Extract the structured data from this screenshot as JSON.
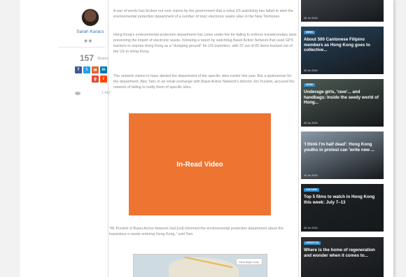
{
  "author": {
    "name": "Sarah Karacs",
    "social_icons": "◉◉",
    "share_count": "157",
    "share_word": "Shares",
    "views": "1,442"
  },
  "social": {
    "facebook_color": "#3b5998",
    "twitter_color": "#1da1f2",
    "email_color": "#e5622a",
    "linkedin_color": "#0077b5",
    "googleplus_color": "#dd4b39",
    "reddit_color": "#ff4500"
  },
  "article": {
    "paragraphs": [
      "A war of words has broken out over claims by the government that a rebut US watchdog has failed to alert the environmental protection department of a number of toxic electronic waste sites in the New Territories.",
      "Hong Kong's environmental protection department has come under fire for failing to enforce transboundary laws preventing the import of electronic waste, following a report by watchdog Basel Action Network that used GPS trackers to expose Hong Kong as a \"dumping ground\" for US exporters, with 37 out of 65 items tracked out of the US to Hong Kong.",
      "The network claims to have alerted the department of the specific sites earlier this year. But a spokesman for the department, Alex Tam, in an email exchange with Basel Action Network's director Jim Puckett, accused the network of failing to notify them of specific sites."
    ],
    "ad_label": "In-Read Video",
    "quote": "\"Mr Puckett of Basel Action Network had [not] informed the environmental protection department about the hazardous e-waste entering Hong Kong,\" said Tam.",
    "map_tag": "View larger map"
  },
  "sidebar": [
    {
      "category": "",
      "title": "",
      "date": "26 Jul 2016",
      "bg": "#3b3f44"
    },
    {
      "category": "NEWS",
      "title": "About 500 Cantonese Filipino members as Hong Kong goes to collective...",
      "date": "26 Jul 2016",
      "bg": "#27445c"
    },
    {
      "category": "NEWS",
      "title": "Underage girls, 'rave'... and handbags: Inside the seedy world of Hong...",
      "date": "26 Jul 2016",
      "bg": "#4d5a52"
    },
    {
      "category": "",
      "title": "'I think I'm half dead': Hong Kong youths in protest can 'write new ...",
      "date": "26 Jul 2016",
      "bg": "#8a9aa8"
    },
    {
      "category": "CULTURE",
      "title": "Top 5 films to watch in Hong Kong this week: July 7–13",
      "date": "26 Jul 2016",
      "bg": "#1f2326"
    },
    {
      "category": "LIFESTYLE",
      "title": "Where is the home of regeneration and wonder when it comes to...",
      "date": "26 Jul 2016",
      "bg": "#2d2f33"
    }
  ]
}
